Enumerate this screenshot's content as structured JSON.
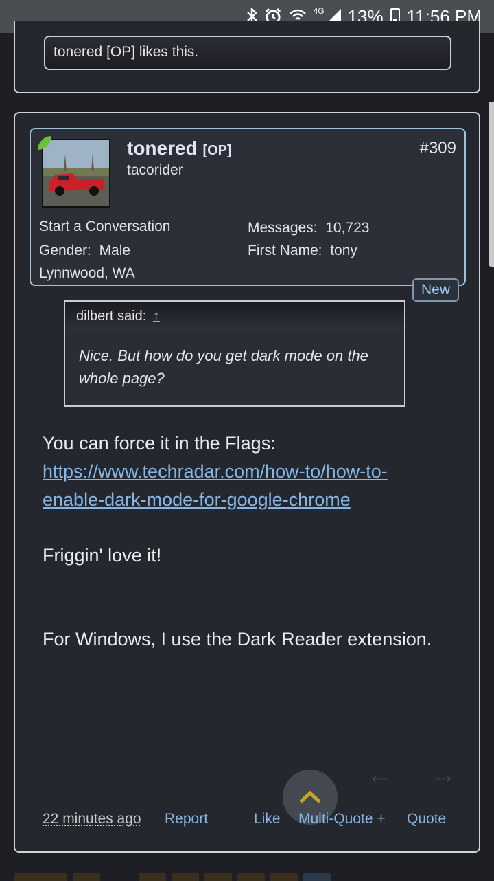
{
  "status_bar": {
    "bluetooth_icon": "bluetooth-icon",
    "alarm_icon": "alarm-icon",
    "wifi_icon": "wifi-icon",
    "network": "4G",
    "battery": "13%",
    "time": "11:56 PM"
  },
  "previous_post": {
    "likes_text": "tonered [OP] likes this."
  },
  "post": {
    "username": "tonered",
    "op_tag": "[OP]",
    "user_title": "tacorider",
    "post_number": "#309",
    "start_conversation": "Start a Conversation",
    "gender_label": "Gender:",
    "gender_value": "Male",
    "location": "Lynnwood, WA",
    "messages_label": "Messages:",
    "messages_value": "10,723",
    "first_name_label": "First Name:",
    "first_name_value": "tony",
    "new_badge": "New",
    "quote": {
      "author": "dilbert said:",
      "jump": "↑",
      "text": "Nice. But how do you get dark mode on the whole page?"
    },
    "message": {
      "line1": "You can force it in the Flags:",
      "link": "https://www.techradar.com/how-to/how-to-enable-dark-mode-for-google-chrome",
      "line2": "Friggin' love it!",
      "line3": "For Windows, I use the Dark Reader extension."
    },
    "footer": {
      "time": "22 minutes ago",
      "report": "Report",
      "like": "Like",
      "multiquote": "Multi-Quote +",
      "quote": "Quote"
    }
  },
  "colors": {
    "background": "#1e1f24",
    "card": "#25272f",
    "link": "#84b7e6",
    "online": "#6dbf3a"
  }
}
